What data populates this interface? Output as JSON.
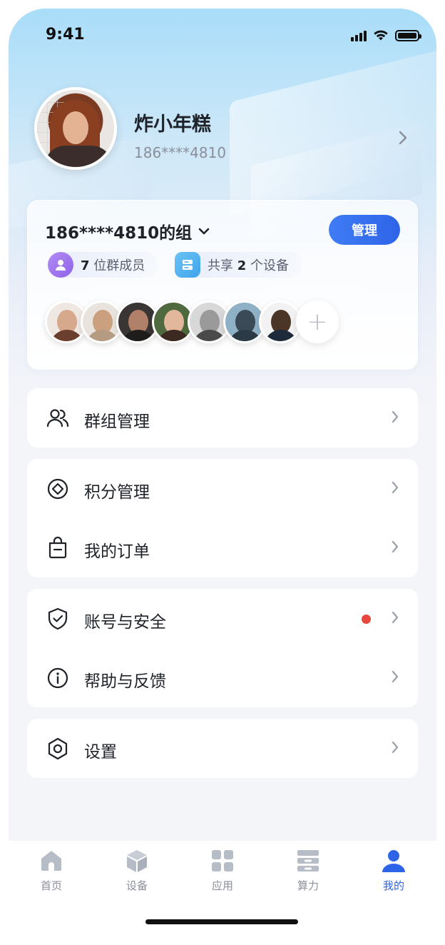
{
  "status_bar": {
    "time": "9:41"
  },
  "profile": {
    "name": "炸小年糕",
    "phone": "186****4810"
  },
  "group": {
    "title": "186****4810的组",
    "manage_label": "管理",
    "members_count": "7",
    "members_suffix": "位群成员",
    "devices_prefix": "共享",
    "devices_count": "2",
    "devices_suffix": "个设备",
    "add_label": "+"
  },
  "menu": {
    "group_manage": "群组管理",
    "points_manage": "积分管理",
    "my_orders": "我的订单",
    "account_security": "账号与安全",
    "help_feedback": "帮助与反馈",
    "settings": "设置"
  },
  "tabs": [
    {
      "label": "首页",
      "icon": "home-icon"
    },
    {
      "label": "设备",
      "icon": "cube-icon"
    },
    {
      "label": "应用",
      "icon": "apps-grid-icon"
    },
    {
      "label": "算力",
      "icon": "server-icon"
    },
    {
      "label": "我的",
      "icon": "profile-icon",
      "active": true
    }
  ],
  "colors": {
    "accent": "#2e64e8",
    "notification_dot": "#e8453c",
    "text_primary": "#1f2329",
    "text_secondary": "#8a8f99"
  }
}
